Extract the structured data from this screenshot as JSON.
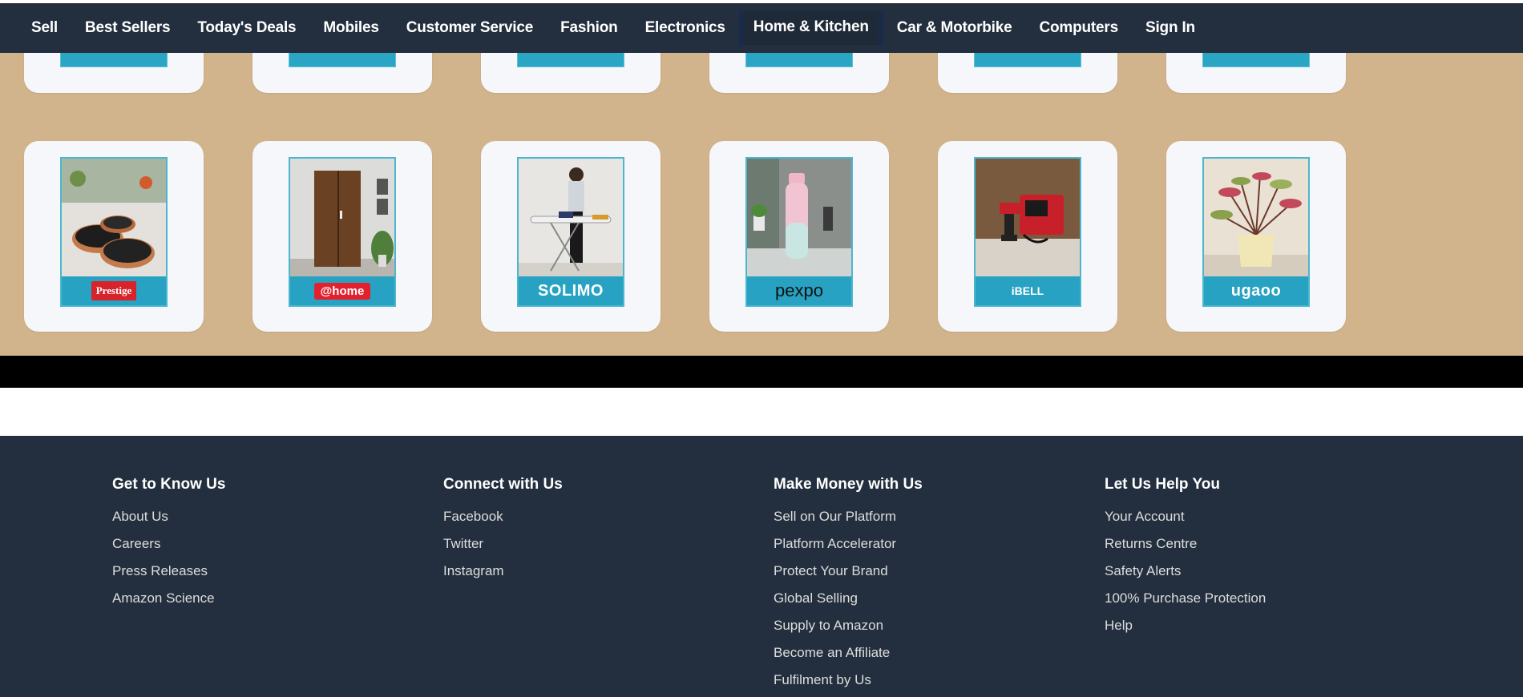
{
  "nav": {
    "items": [
      "Sell",
      "Best Sellers",
      "Today's Deals",
      "Mobiles",
      "Customer Service",
      "Fashion",
      "Electronics",
      "Home & Kitchen",
      "Car & Motorbike",
      "Computers",
      "Sign In"
    ],
    "active": "Home & Kitchen"
  },
  "brands": {
    "row2": [
      "Prestige",
      "@home",
      "SOLIMO",
      "pexpo",
      "iBELL",
      "ugaoo"
    ]
  },
  "footer": {
    "columns": [
      {
        "title": "Get to Know Us",
        "links": [
          "About Us",
          "Careers",
          "Press Releases",
          "Amazon Science"
        ]
      },
      {
        "title": "Connect with Us",
        "links": [
          "Facebook",
          "Twitter",
          "Instagram"
        ]
      },
      {
        "title": "Make Money with Us",
        "links": [
          "Sell on Our Platform",
          "Platform Accelerator",
          "Protect Your Brand",
          "Global Selling",
          "Supply to Amazon",
          "Become an Affiliate",
          "Fulfilment by Us"
        ]
      },
      {
        "title": "Let Us Help You",
        "links": [
          "Your Account",
          "Returns Centre",
          "Safety Alerts",
          "100% Purchase Protection",
          "Help"
        ]
      }
    ]
  },
  "colors": {
    "nav_bg": "#232f3e",
    "page_band": "#d2b48c",
    "card_bg": "#f5f7fa",
    "brand_strip": "#27a2c2",
    "footer_bg": "#232f3e"
  }
}
